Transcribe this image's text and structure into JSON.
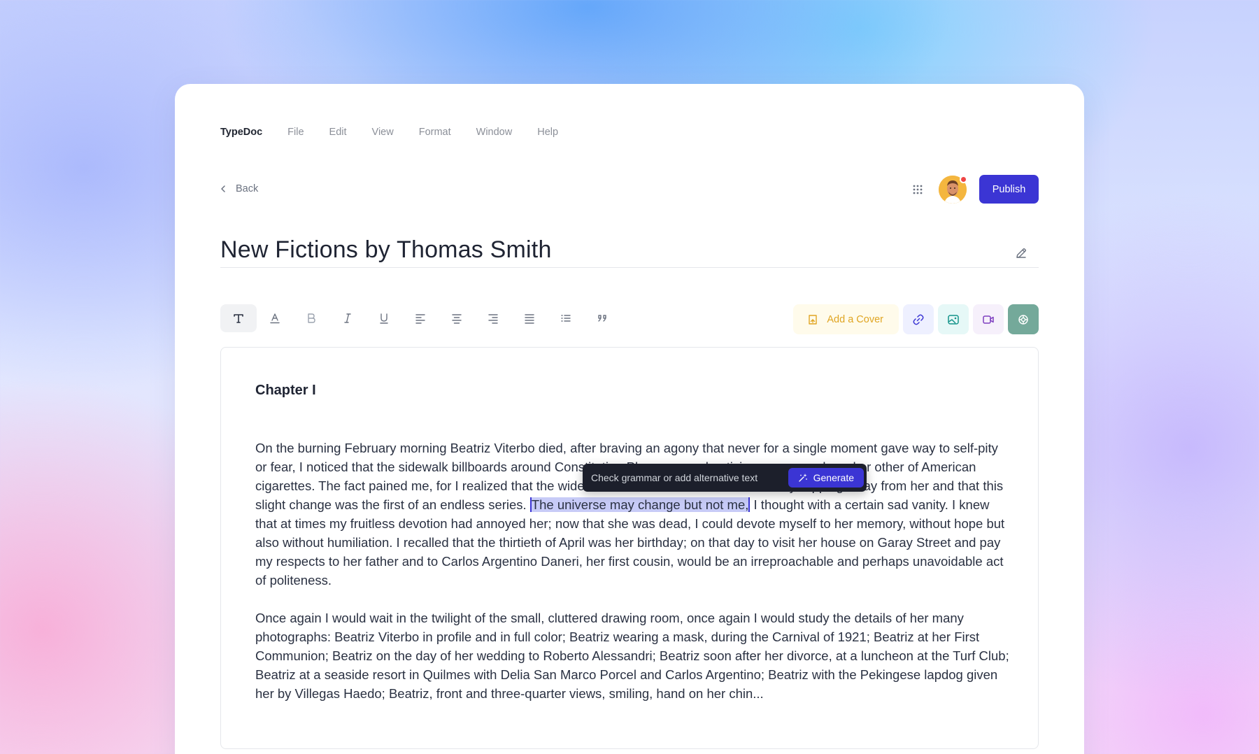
{
  "menu": {
    "brand": "TypeDoc",
    "items": [
      "File",
      "Edit",
      "View",
      "Format",
      "Window",
      "Help"
    ]
  },
  "header": {
    "back_label": "Back",
    "publish_label": "Publish"
  },
  "document": {
    "title": "New Fictions by Thomas Smith",
    "chapter": "Chapter I",
    "p1_before": "On the burning February morning Beatriz Viterbo died, after braving an agony that never for a single moment gave way to self-pity or fear, I noticed that the sidewalk billboards around Constitution Plaza were advertising some new brand or other of American cigarettes. The fact pained me, for I realized that the wide and ceaseless universe was already slipping away from her and that this slight change was the first of an endless series.",
    "p1_selected": "The universe may change but not me,",
    "p1_after": "I thought with a certain sad vanity. I knew that at times my fruitless devotion had annoyed her; now that she was dead, I could devote myself to her memory, without hope but also without humiliation. I recalled that the thirtieth of April was her birthday; on that day to visit her house on Garay Street and pay my respects to her father and to Carlos Argentino Daneri, her first cousin, would be an irreproachable and perhaps unavoidable act of politeness.",
    "p2": "Once again I would wait in the twilight of the small, cluttered drawing room, once again I would study the details of her many photographs: Beatriz Viterbo in profile and in full color; Beatriz wearing a mask, during the Carnival of 1921; Beatriz at her First Communion; Beatriz on the day of her wedding to Roberto Alessandri; Beatriz soon after her divorce, at a luncheon at the Turf Club; Beatriz at a seaside resort in Quilmes with Delia San Marco Porcel and Carlos Argentino; Beatriz with the Pekingese lapdog given her by Villegas Haedo; Beatriz, front and three-quarter views, smiling, hand on her chin..."
  },
  "toolbar": {
    "cover_label": "Add a Cover",
    "tools": [
      "text-icon",
      "font-color-icon",
      "bold-icon",
      "italic-icon",
      "underline-icon",
      "align-left-icon",
      "align-center-icon",
      "align-right-icon",
      "justify-icon",
      "list-icon",
      "quote-icon"
    ]
  },
  "popover": {
    "hint": "Check grammar or add alternative text",
    "generate_label": "Generate"
  },
  "colors": {
    "accent": "#3b35d4",
    "cover": "#e0a522",
    "ai": "#74a99a",
    "notification": "#ef4444"
  }
}
